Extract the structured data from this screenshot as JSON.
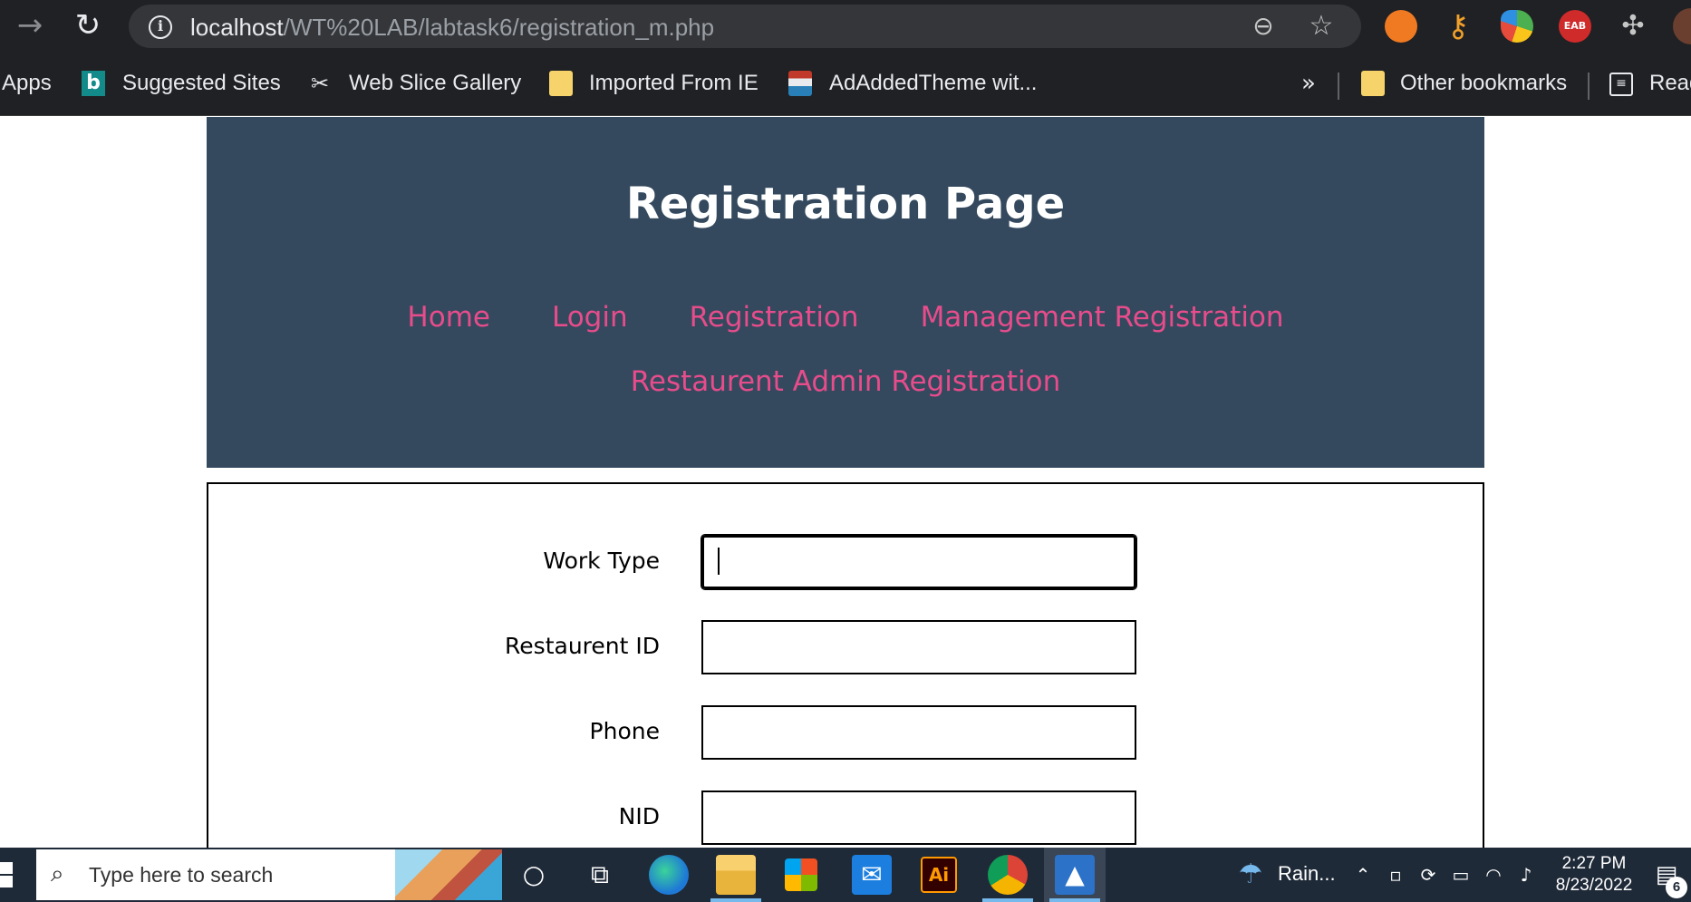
{
  "browser": {
    "url_host": "localhost",
    "url_path": "/WT%20LAB/labtask6/registration_m.php"
  },
  "bookmarks": {
    "apps": "Apps",
    "items": [
      "Suggested Sites",
      "Web Slice Gallery",
      "Imported From IE",
      "AdAddedTheme wit..."
    ],
    "overflow": "»",
    "other": "Other bookmarks",
    "reading": "Read"
  },
  "extensions": {
    "ext4_label": "EAB"
  },
  "page": {
    "title": "Registration Page",
    "nav": [
      "Home",
      "Login",
      "Registration",
      "Management Registration",
      "Restaurent Admin Registration"
    ],
    "form": {
      "fields": [
        {
          "label": "Work Type",
          "value": ""
        },
        {
          "label": "Restaurent ID",
          "value": ""
        },
        {
          "label": "Phone",
          "value": ""
        },
        {
          "label": "NID",
          "value": ""
        }
      ]
    }
  },
  "taskbar": {
    "search_placeholder": "Type here to search",
    "illustrator_label": "Ai",
    "weather": "Rain...",
    "time": "2:27 PM",
    "date": "8/23/2022",
    "notifications": "6"
  }
}
